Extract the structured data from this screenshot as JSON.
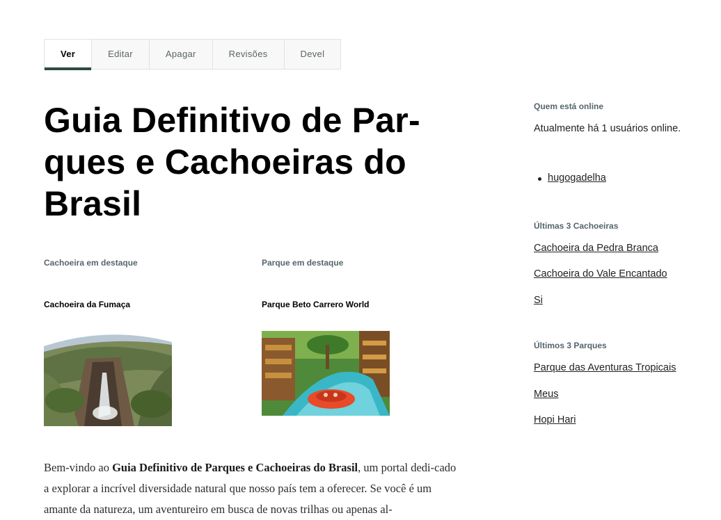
{
  "tabs": [
    {
      "label": "Ver",
      "active": true
    },
    {
      "label": "Editar"
    },
    {
      "label": "Apagar"
    },
    {
      "label": "Revisões"
    },
    {
      "label": "Devel"
    }
  ],
  "page": {
    "title": "Guia Definitivo de Par-ques e Cachoeiras do Brasil"
  },
  "featured": {
    "waterfall": {
      "label": "Cachoeira em destaque",
      "name": "Cachoeira da Fumaça"
    },
    "park": {
      "label": "Parque em destaque",
      "name": "Parque Beto Carrero World"
    }
  },
  "intro": {
    "prefix": "Bem-vindo ao ",
    "bold": "Guia Definitivo de Parques e Cachoeiras do Brasil",
    "rest": ", um portal dedi-cado a explorar a incrível diversidade natural que nosso país tem a oferecer. Se você é um amante da natureza, um aventureiro em busca de novas trilhas ou apenas al-"
  },
  "sidebar": {
    "online": {
      "heading": "Quem está online",
      "text": "Atualmente há 1 usuários online.",
      "users": [
        "hugogadelha"
      ]
    },
    "waterfalls": {
      "heading": "Últimas 3 Cachoeiras",
      "links": [
        "Cachoeira da Pedra Branca",
        "Cachoeira do Vale Encantado",
        "Si"
      ]
    },
    "parks": {
      "heading": "Últimos 3 Parques",
      "links": [
        "Parque das Aventuras Tropicais",
        "Meus",
        "Hopi Hari"
      ]
    }
  },
  "colors": {
    "active_tab_underline": "#2e4a40",
    "label_gray": "#55656b"
  }
}
